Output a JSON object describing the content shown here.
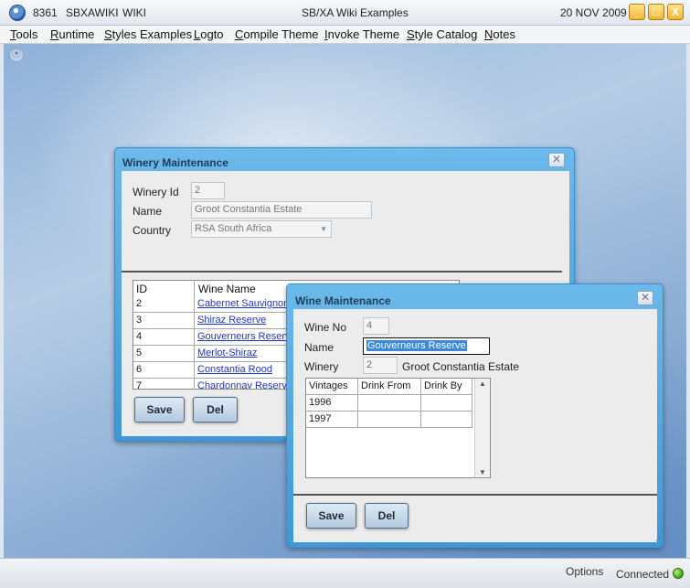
{
  "titlebar": {
    "session": "8361",
    "system": "SBXAWIKI",
    "account": "WIKI",
    "title": "SB/XA Wiki Examples",
    "date": "20 NOV 2009",
    "minimize": "_",
    "maximize": "□",
    "close": "X"
  },
  "menu": [
    "Tools",
    "Runtime",
    "Styles Examples",
    "Logto",
    "Compile Theme",
    "Invoke Theme",
    "Style Catalog",
    "Notes"
  ],
  "winery": {
    "title": "Winery Maintenance",
    "id_label": "Winery Id",
    "id_value": "2",
    "name_label": "Name",
    "name_value": "Groot Constantia Estate",
    "country_label": "Country",
    "country_value": "RSA South Africa",
    "grid_headers": [
      "ID",
      "Wine Name"
    ],
    "rows": [
      {
        "id": "2",
        "name": "Cabernet Sauvignon"
      },
      {
        "id": "3",
        "name": "Shiraz Reserve"
      },
      {
        "id": "4",
        "name": "Gouverneurs Reserve"
      },
      {
        "id": "5",
        "name": "Merlot-Shiraz"
      },
      {
        "id": "6",
        "name": "Constantia Rood"
      },
      {
        "id": "7",
        "name": "Chardonnay Reserve"
      }
    ],
    "save": "Save",
    "del": "Del"
  },
  "wine": {
    "title": "Wine Maintenance",
    "no_label": "Wine No",
    "no_value": "4",
    "name_label": "Name",
    "name_value": "Gouverneurs Reserve",
    "winery_label": "Winery",
    "winery_id": "2",
    "winery_name": "Groot Constantia Estate",
    "grid_headers": [
      "Vintages",
      "Drink From",
      "Drink By"
    ],
    "rows": [
      {
        "vintage": "1996",
        "from": "",
        "by": ""
      },
      {
        "vintage": "1997",
        "from": "",
        "by": ""
      }
    ],
    "save": "Save",
    "del": "Del"
  },
  "status": {
    "options": "Options",
    "connected": "Connected"
  },
  "icons": {
    "app": "app-logo-icon",
    "close": "close-icon",
    "status": "connection-status-icon"
  }
}
